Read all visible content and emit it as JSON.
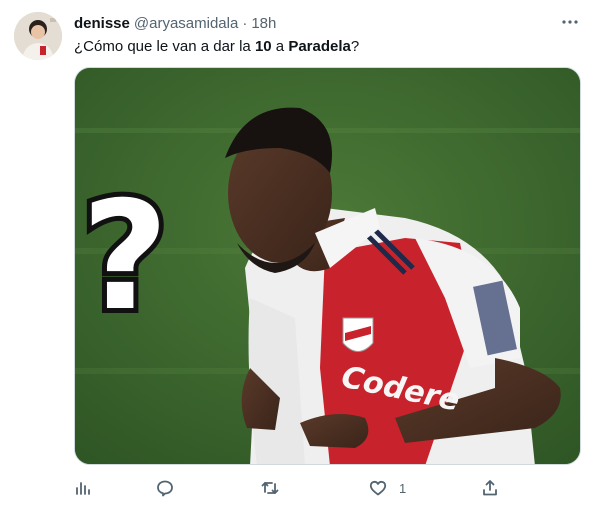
{
  "tweet": {
    "display_name": "denisse",
    "handle": "@aryasamidala",
    "separator": "·",
    "time": "18h",
    "text": {
      "part1": "¿Cómo que le van a dar la ",
      "bold1": "10",
      "part2": " a ",
      "bold2": "Paradela",
      "part3": "?"
    },
    "media": {
      "question_mark": "?",
      "shirt_text": "Codere"
    },
    "actions": {
      "views_icon": "views-icon",
      "reply_icon": "reply-icon",
      "retweet_icon": "retweet-icon",
      "like_icon": "heart-icon",
      "like_count": "1",
      "share_icon": "share-icon"
    }
  },
  "colors": {
    "text": "#0f1419",
    "secondary": "#536471",
    "border": "#cfd9de",
    "pitch": "#3f6a30",
    "jersey_red": "#c8232c",
    "jersey_white": "#f1f1f1"
  }
}
